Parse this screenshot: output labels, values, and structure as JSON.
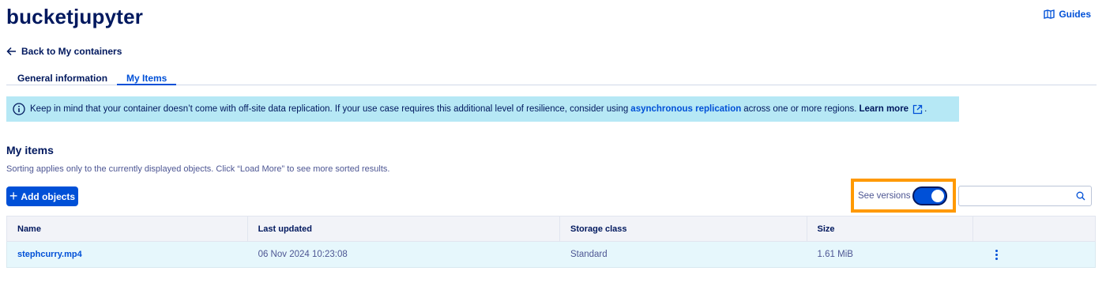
{
  "header": {
    "title": "bucketjupyter",
    "guides_label": "Guides"
  },
  "nav": {
    "back_label": "Back to My containers"
  },
  "tabs": [
    {
      "label": "General information",
      "active": false
    },
    {
      "label": "My Items",
      "active": true
    }
  ],
  "banner": {
    "text_before": "Keep in mind that your container doesn’t come with off-site data replication. If your use case requires this additional level of resilience, consider using",
    "link_label": "asynchronous replication",
    "text_after": "across one or more regions.",
    "learn_more_label": "Learn more",
    "end": "."
  },
  "items_section": {
    "title": "My items",
    "subtitle": "Sorting applies only to the currently displayed objects. Click “Load More” to see more sorted results.",
    "add_button_label": "Add objects",
    "versions_label": "See versions",
    "versions_enabled": true,
    "search_placeholder": ""
  },
  "table": {
    "columns": [
      "Name",
      "Last updated",
      "Storage class",
      "Size",
      ""
    ],
    "rows": [
      {
        "name": "stephcurry.mp4",
        "last_updated": "06 Nov 2024 10:23:08",
        "storage_class": "Standard",
        "size": "1.61 MiB"
      }
    ]
  },
  "colors": {
    "primary": "#0050d7",
    "text": "#00185e",
    "banner_bg": "#b6e8f5",
    "highlight": "#ff9900",
    "row_bg": "#e6f7fc"
  }
}
